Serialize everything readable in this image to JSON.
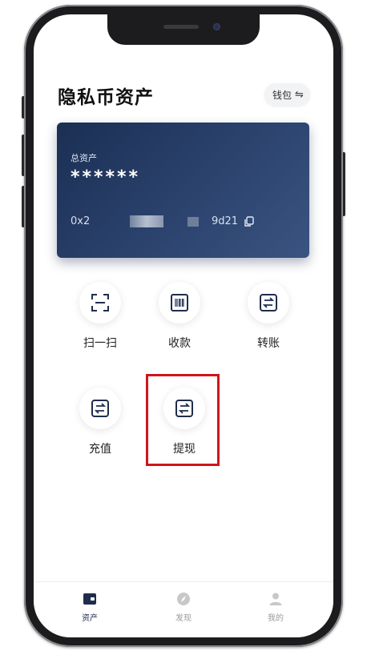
{
  "header": {
    "title": "隐私币资产",
    "wallet_label": "钱包",
    "wallet_icon": "swap-icon"
  },
  "card": {
    "total_label": "总资产",
    "balance_masked": "******",
    "address_prefix": "0x2",
    "address_suffix": "9d21",
    "copy_icon": "copy-icon"
  },
  "actions": [
    {
      "label": "扫一扫",
      "icon": "scan-icon"
    },
    {
      "label": "收款",
      "icon": "barcode-icon"
    },
    {
      "label": "转账",
      "icon": "transfer-icon"
    },
    {
      "label": "充值",
      "icon": "transfer-icon"
    },
    {
      "label": "提现",
      "icon": "transfer-icon",
      "highlighted": true
    }
  ],
  "tabbar": [
    {
      "label": "资产",
      "icon": "wallet-icon",
      "active": true
    },
    {
      "label": "发现",
      "icon": "compass-icon",
      "active": false
    },
    {
      "label": "我的",
      "icon": "user-icon",
      "active": false
    }
  ],
  "colors": {
    "card": "#1b2f54",
    "highlight": "#d0151b",
    "active_tab": "#1f2d4d"
  }
}
